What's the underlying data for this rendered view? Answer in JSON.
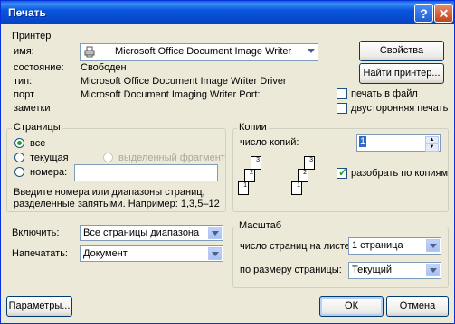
{
  "window": {
    "title": "Печать",
    "help_symbol": "?",
    "close_symbol": "✕"
  },
  "printer": {
    "legend": "Принтер",
    "name_label": "имя:",
    "name_value": "Microsoft Office Document Image Writer",
    "status_label": "состояние:",
    "status_value": "Свободен",
    "type_label": "тип:",
    "type_value": "Microsoft Office Document Image Writer Driver",
    "port_label": "порт",
    "port_value": "Microsoft Document Imaging Writer Port:",
    "notes_label": "заметки",
    "properties_button": "Свойства",
    "find_printer_button": "Найти принтер...",
    "print_to_file_label": "печать в файл",
    "duplex_label": "двусторонняя печать"
  },
  "pages": {
    "legend": "Страницы",
    "all_label": "все",
    "current_label": "текущая",
    "selection_label": "выделенный фрагмент",
    "numbers_label": "номера:",
    "hint_line1": "Введите номера или диапазоны страниц,",
    "hint_line2": "разделенные запятыми. Например: 1,3,5–12"
  },
  "copies": {
    "legend": "Копии",
    "count_label": "число копий:",
    "count_value": "1",
    "collate_label": "разобрать по копиям",
    "icon_pages": [
      "3",
      "2",
      "1"
    ]
  },
  "print_what": {
    "label": "Включить:",
    "value": "Все страницы диапазона"
  },
  "print_item": {
    "label": "Напечатать:",
    "value": "Документ"
  },
  "zoom": {
    "legend": "Масштаб",
    "pages_per_sheet_label": "число страниц на листе:",
    "pages_per_sheet_value": "1 страница",
    "scale_label": "по размеру страницы:",
    "scale_value": "Текущий"
  },
  "footer": {
    "options_button": "Параметры...",
    "ok_button": "ОК",
    "cancel_button": "Отмена"
  }
}
